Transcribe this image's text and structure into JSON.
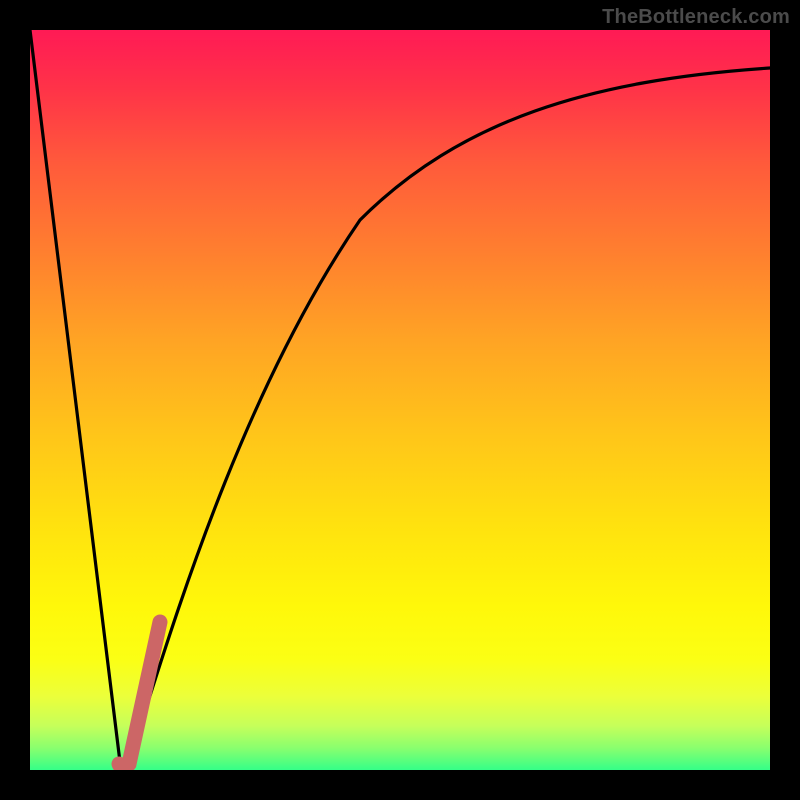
{
  "watermark": "TheBottleneck.com",
  "colors": {
    "curve": "#000000",
    "highlight": "#cc6666",
    "plot_border": "#000000"
  },
  "chart_data": {
    "type": "line",
    "title": "",
    "xlabel": "",
    "ylabel": "",
    "xlim": [
      0,
      100
    ],
    "ylim": [
      0,
      100
    ],
    "series": [
      {
        "name": "v-curve",
        "x": [
          0,
          2,
          4,
          6,
          8,
          10,
          11,
          12,
          12.5,
          13,
          14,
          16,
          18,
          20,
          22,
          25,
          30,
          35,
          40,
          45,
          50,
          55,
          60,
          65,
          70,
          75,
          80,
          85,
          90,
          95,
          100
        ],
        "y": [
          100,
          84,
          68,
          52,
          36,
          20,
          12,
          4,
          0.5,
          2,
          9,
          23,
          35,
          45,
          53,
          62,
          72,
          78,
          82,
          85,
          87,
          88.5,
          90,
          91,
          92,
          92.7,
          93.3,
          93.8,
          94.2,
          94.6,
          95
        ]
      },
      {
        "name": "highlight-segment",
        "x": [
          12.3,
          12.8,
          13.5,
          14.5,
          15.5,
          16.3,
          17.0
        ],
        "y": [
          0.8,
          1.0,
          2.5,
          6.5,
          11.5,
          16.0,
          20.0
        ]
      }
    ]
  }
}
